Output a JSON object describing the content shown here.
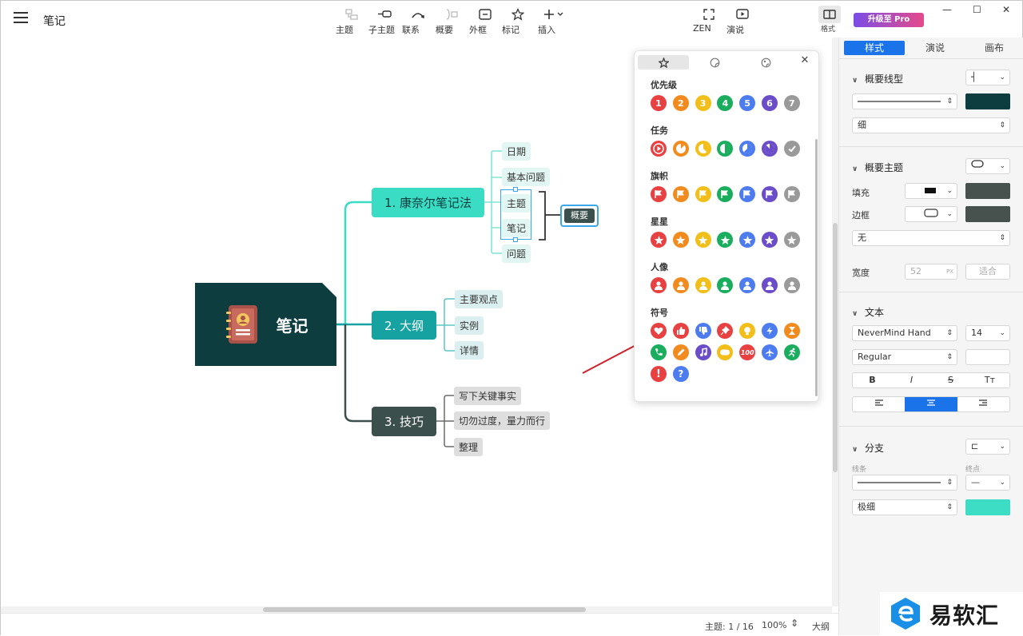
{
  "window": {
    "title": "笔记",
    "minimize": "—",
    "maximize": "☐",
    "close": "✕"
  },
  "toolbar": {
    "items": [
      {
        "label": "主题",
        "icon": "topic-icon",
        "enabled": false
      },
      {
        "label": "子主题",
        "icon": "subtopic-icon",
        "enabled": true
      },
      {
        "label": "联系",
        "icon": "relationship-icon",
        "enabled": true
      },
      {
        "label": "概要",
        "icon": "summary-icon",
        "enabled": false
      },
      {
        "label": "外框",
        "icon": "boundary-icon",
        "enabled": true
      },
      {
        "label": "标记",
        "icon": "marker-star-icon",
        "enabled": true
      },
      {
        "label": "插入",
        "icon": "insert-plus-icon",
        "enabled": true
      }
    ],
    "zen_label": "ZEN",
    "present_label": "演说",
    "format_label": "格式",
    "pro_label": "升级至 Pro"
  },
  "mindmap": {
    "root": "笔记",
    "branches": [
      {
        "label": "1. 康奈尔笔记法",
        "children": [
          "日期",
          "基本问题",
          "主题",
          "笔记",
          "问题"
        ],
        "summary": "概要"
      },
      {
        "label": "2. 大纲",
        "children": [
          "主要观点",
          "实例",
          "详情"
        ]
      },
      {
        "label": "3. 技巧",
        "children": [
          "写下关键事实",
          "切勿过度，量力而行",
          "整理"
        ]
      }
    ]
  },
  "marker_panel": {
    "sections": [
      {
        "title": "优先级",
        "type": "priority",
        "items": [
          "1",
          "2",
          "3",
          "4",
          "5",
          "6",
          "7"
        ]
      },
      {
        "title": "任务",
        "type": "task",
        "items": [
          "0",
          "1/8",
          "3/8",
          "1/2",
          "5/8",
          "7/8",
          "done"
        ]
      },
      {
        "title": "旗帜",
        "type": "flag",
        "items": [
          "red",
          "orange",
          "yellow",
          "green",
          "blue",
          "purple",
          "gray"
        ]
      },
      {
        "title": "星星",
        "type": "star",
        "items": [
          "red",
          "orange",
          "yellow",
          "green",
          "blue",
          "purple",
          "gray"
        ]
      },
      {
        "title": "人像",
        "type": "person",
        "items": [
          "red",
          "orange",
          "yellow",
          "green",
          "blue",
          "purple",
          "gray"
        ]
      },
      {
        "title": "符号",
        "type": "symbol",
        "items": [
          "heart",
          "thumbs-up",
          "thumbs-down",
          "pin",
          "idea",
          "lightning",
          "hourglass",
          "phone",
          "pencil",
          "music",
          "game",
          "100",
          "plane",
          "run",
          "exclamation",
          "question"
        ]
      }
    ],
    "colors": [
      "#e84142",
      "#f28b1e",
      "#f2be1a",
      "#1aad5e",
      "#4d7cf0",
      "#6b4cc9",
      "#9a9a9a"
    ]
  },
  "sidebar": {
    "tabs": [
      "样式",
      "演说",
      "画布"
    ],
    "summary_line": {
      "title": "概要线型",
      "weight": "细",
      "color": "#0e3d3f"
    },
    "summary_topic": {
      "title": "概要主题",
      "fill_label": "填充",
      "border_label": "边框",
      "border_style": "无",
      "width_label": "宽度",
      "width_value": "52",
      "width_unit": "PX",
      "fit_label": "适合",
      "fill_color": "#47524e",
      "border_color": "#47524e"
    },
    "text": {
      "title": "文本",
      "font": "NeverMind Hand",
      "size": "14",
      "weight": "Regular",
      "bold": "B",
      "italic": "I",
      "strike": "S",
      "case": "Tт"
    },
    "branch": {
      "title": "分支",
      "line_label": "线条",
      "end_label": "终点",
      "weight": "极细",
      "color": "#3ddcc4"
    }
  },
  "status": {
    "topics": "主题: 1 / 16",
    "zoom": "100%",
    "view": "大纲"
  },
  "watermark": {
    "text": "易软汇"
  }
}
